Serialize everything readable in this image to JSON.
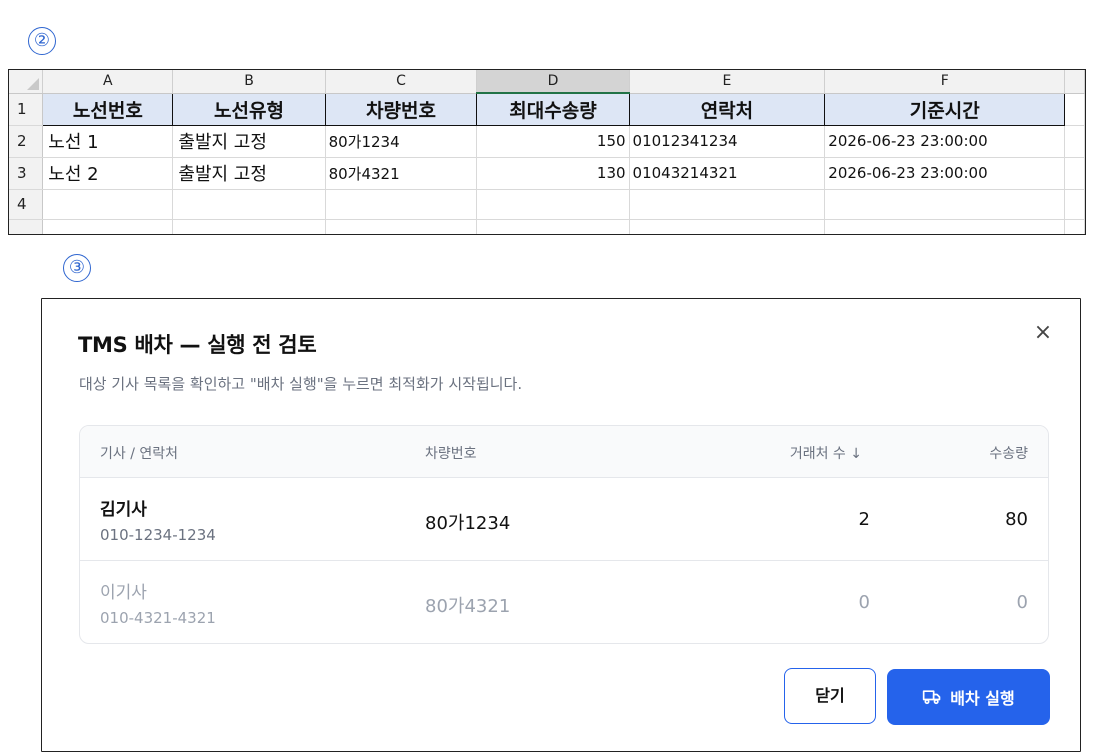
{
  "markers": {
    "first": "②",
    "second": "③"
  },
  "sheet": {
    "col_letters": [
      "A",
      "B",
      "C",
      "D",
      "E",
      "F"
    ],
    "selected_col": "D",
    "row_numbers": [
      "1",
      "2",
      "3",
      "4"
    ],
    "headers": [
      "노선번호",
      "노선유형",
      "차량번호",
      "최대수송량",
      "연락처",
      "기준시간"
    ],
    "rows": [
      [
        "노선 1",
        "출발지 고정",
        "80가1234",
        "150",
        "01012341234",
        "2026-06-23 23:00:00"
      ],
      [
        "노선 2",
        "출발지 고정",
        "80가4321",
        "130",
        "01043214321",
        "2026-06-23 23:00:00"
      ]
    ]
  },
  "modal": {
    "title": "TMS 배차 — 실행 전 검토",
    "subtitle": "대상 기사 목록을 확인하고 \"배차 실행\"을 누르면 최적화가 시작됩니다.",
    "close_icon": "×",
    "columns": [
      "기사 / 연락처",
      "차량번호",
      "거래처 수 ↓",
      "수송량"
    ],
    "drivers": [
      {
        "name": "김기사",
        "phone": "010-1234-1234",
        "vehicle": "80가1234",
        "clients": "2",
        "volume": "80",
        "active": true
      },
      {
        "name": "이기사",
        "phone": "010-4321-4321",
        "vehicle": "80가4321",
        "clients": "0",
        "volume": "0",
        "active": false
      }
    ],
    "buttons": {
      "cancel": "닫기",
      "run": "배차 실행",
      "run_icon": "truck-icon"
    },
    "colors": {
      "primary": "#2563eb",
      "muted": "#9ca3af"
    }
  }
}
